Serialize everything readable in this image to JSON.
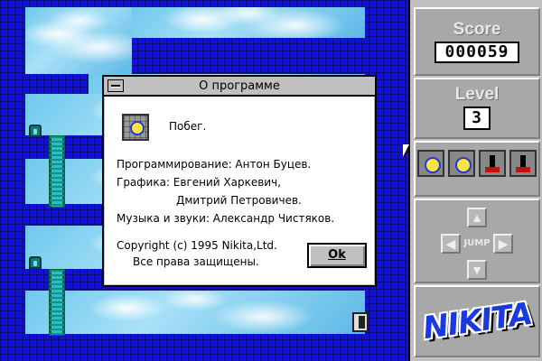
{
  "dialog": {
    "title": "О программе",
    "game_name": "Побег.",
    "programming": "Программирование: Антон Буцев.",
    "graphics_line1": "Графика: Евгений Харкевич,",
    "graphics_line2": "Дмитрий Петровичев.",
    "music": "Музыка и звуки: Александр Чистяков.",
    "copyright": "Copyright (c) 1995 Nikita,Ltd.",
    "rights": "Все права защищены.",
    "ok_label": "Ok",
    "icon": "game-character-icon"
  },
  "panel": {
    "score_label": "Score",
    "score_value": "000059",
    "level_label": "Level",
    "level_value": "3",
    "inventory": [
      {
        "icon": "smiley-block-icon"
      },
      {
        "icon": "smiley-block-icon"
      },
      {
        "icon": "bomb-block-icon"
      },
      {
        "icon": "bomb-block-icon"
      }
    ],
    "jump_label": "JUMP",
    "logo_text": "NIKITA"
  },
  "colors": {
    "wall": "#1010d8",
    "panel": "#c0c0c0",
    "logo": "#1a3adf"
  }
}
